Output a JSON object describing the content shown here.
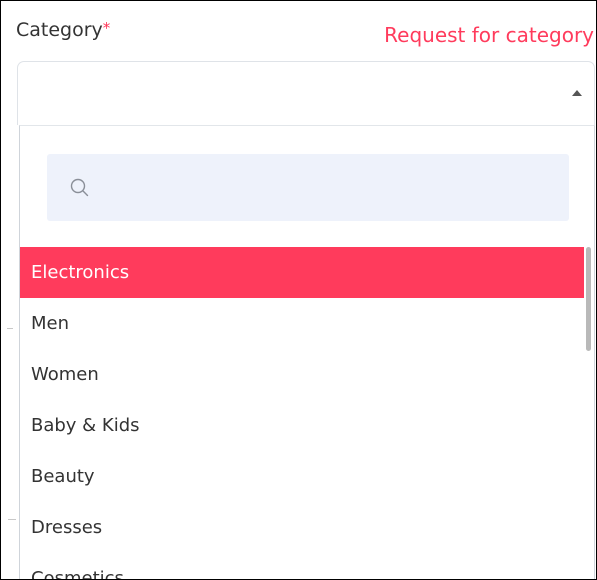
{
  "field": {
    "label": "Category",
    "required_mark": "*",
    "request_link": "Request for category",
    "selected_value": ""
  },
  "search": {
    "placeholder": "",
    "value": ""
  },
  "options": [
    {
      "label": "Electronics",
      "selected": true
    },
    {
      "label": "Men",
      "selected": false
    },
    {
      "label": "Women",
      "selected": false
    },
    {
      "label": "Baby & Kids",
      "selected": false
    },
    {
      "label": "Beauty",
      "selected": false
    },
    {
      "label": "Dresses",
      "selected": false
    },
    {
      "label": "Cosmetics",
      "selected": false
    }
  ],
  "icons": {
    "search": "search-icon",
    "caret": "caret-up-icon"
  },
  "colors": {
    "accent": "#ff3b5c",
    "search_bg": "#eef2fb",
    "text": "#333333"
  }
}
